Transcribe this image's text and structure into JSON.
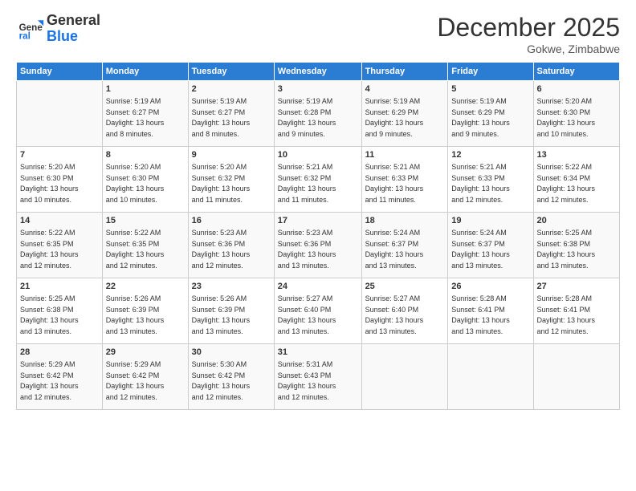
{
  "header": {
    "logo_general": "General",
    "logo_blue": "Blue",
    "month_title": "December 2025",
    "location": "Gokwe, Zimbabwe"
  },
  "days_of_week": [
    "Sunday",
    "Monday",
    "Tuesday",
    "Wednesday",
    "Thursday",
    "Friday",
    "Saturday"
  ],
  "weeks": [
    [
      {
        "day": "",
        "info": ""
      },
      {
        "day": "1",
        "info": "Sunrise: 5:19 AM\nSunset: 6:27 PM\nDaylight: 13 hours\nand 8 minutes."
      },
      {
        "day": "2",
        "info": "Sunrise: 5:19 AM\nSunset: 6:27 PM\nDaylight: 13 hours\nand 8 minutes."
      },
      {
        "day": "3",
        "info": "Sunrise: 5:19 AM\nSunset: 6:28 PM\nDaylight: 13 hours\nand 9 minutes."
      },
      {
        "day": "4",
        "info": "Sunrise: 5:19 AM\nSunset: 6:29 PM\nDaylight: 13 hours\nand 9 minutes."
      },
      {
        "day": "5",
        "info": "Sunrise: 5:19 AM\nSunset: 6:29 PM\nDaylight: 13 hours\nand 9 minutes."
      },
      {
        "day": "6",
        "info": "Sunrise: 5:20 AM\nSunset: 6:30 PM\nDaylight: 13 hours\nand 10 minutes."
      }
    ],
    [
      {
        "day": "7",
        "info": ""
      },
      {
        "day": "8",
        "info": "Sunrise: 5:20 AM\nSunset: 6:30 PM\nDaylight: 13 hours\nand 10 minutes."
      },
      {
        "day": "9",
        "info": "Sunrise: 5:20 AM\nSunset: 6:32 PM\nDaylight: 13 hours\nand 11 minutes."
      },
      {
        "day": "10",
        "info": "Sunrise: 5:21 AM\nSunset: 6:32 PM\nDaylight: 13 hours\nand 11 minutes."
      },
      {
        "day": "11",
        "info": "Sunrise: 5:21 AM\nSunset: 6:33 PM\nDaylight: 13 hours\nand 11 minutes."
      },
      {
        "day": "12",
        "info": "Sunrise: 5:21 AM\nSunset: 6:33 PM\nDaylight: 13 hours\nand 12 minutes."
      },
      {
        "day": "13",
        "info": "Sunrise: 5:22 AM\nSunset: 6:34 PM\nDaylight: 13 hours\nand 12 minutes."
      }
    ],
    [
      {
        "day": "14",
        "info": ""
      },
      {
        "day": "15",
        "info": "Sunrise: 5:22 AM\nSunset: 6:35 PM\nDaylight: 13 hours\nand 12 minutes."
      },
      {
        "day": "16",
        "info": "Sunrise: 5:23 AM\nSunset: 6:36 PM\nDaylight: 13 hours\nand 12 minutes."
      },
      {
        "day": "17",
        "info": "Sunrise: 5:23 AM\nSunset: 6:36 PM\nDaylight: 13 hours\nand 13 minutes."
      },
      {
        "day": "18",
        "info": "Sunrise: 5:24 AM\nSunset: 6:37 PM\nDaylight: 13 hours\nand 13 minutes."
      },
      {
        "day": "19",
        "info": "Sunrise: 5:24 AM\nSunset: 6:37 PM\nDaylight: 13 hours\nand 13 minutes."
      },
      {
        "day": "20",
        "info": "Sunrise: 5:25 AM\nSunset: 6:38 PM\nDaylight: 13 hours\nand 13 minutes."
      }
    ],
    [
      {
        "day": "21",
        "info": ""
      },
      {
        "day": "22",
        "info": "Sunrise: 5:26 AM\nSunset: 6:39 PM\nDaylight: 13 hours\nand 13 minutes."
      },
      {
        "day": "23",
        "info": "Sunrise: 5:26 AM\nSunset: 6:39 PM\nDaylight: 13 hours\nand 13 minutes."
      },
      {
        "day": "24",
        "info": "Sunrise: 5:27 AM\nSunset: 6:40 PM\nDaylight: 13 hours\nand 13 minutes."
      },
      {
        "day": "25",
        "info": "Sunrise: 5:27 AM\nSunset: 6:40 PM\nDaylight: 13 hours\nand 13 minutes."
      },
      {
        "day": "26",
        "info": "Sunrise: 5:28 AM\nSunset: 6:41 PM\nDaylight: 13 hours\nand 13 minutes."
      },
      {
        "day": "27",
        "info": "Sunrise: 5:28 AM\nSunset: 6:41 PM\nDaylight: 13 hours\nand 12 minutes."
      }
    ],
    [
      {
        "day": "28",
        "info": "Sunrise: 5:29 AM\nSunset: 6:42 PM\nDaylight: 13 hours\nand 12 minutes."
      },
      {
        "day": "29",
        "info": "Sunrise: 5:29 AM\nSunset: 6:42 PM\nDaylight: 13 hours\nand 12 minutes."
      },
      {
        "day": "30",
        "info": "Sunrise: 5:30 AM\nSunset: 6:42 PM\nDaylight: 13 hours\nand 12 minutes."
      },
      {
        "day": "31",
        "info": "Sunrise: 5:31 AM\nSunset: 6:43 PM\nDaylight: 13 hours\nand 12 minutes."
      },
      {
        "day": "",
        "info": ""
      },
      {
        "day": "",
        "info": ""
      },
      {
        "day": "",
        "info": ""
      }
    ]
  ]
}
